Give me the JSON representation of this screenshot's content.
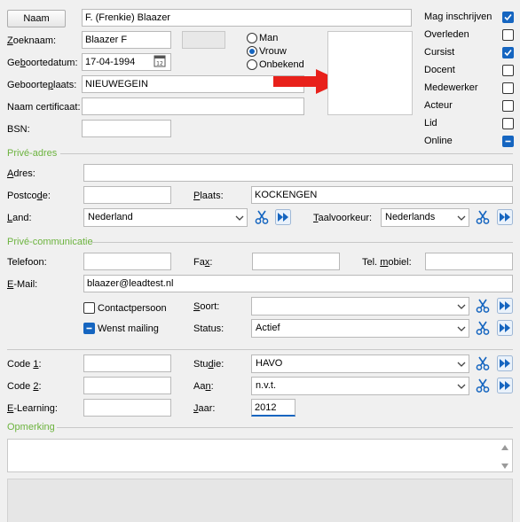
{
  "top": {
    "naam_button": "Naam",
    "naam_value": "F. (Frenkie) Blaazer",
    "zoeknaam_label": "Zoeknaam:",
    "zoeknaam_value": "Blaazer F",
    "geboortedatum_label": "Geboortedatum:",
    "geboortedatum_value": "17-04-1994",
    "geboorteplaats_label": "Geboorteplaats:",
    "geboorteplaats_value": "NIEUWEGEIN",
    "naam_certificaat_label": "Naam certificaat:",
    "naam_certificaat_value": "",
    "bsn_label": "BSN:",
    "bsn_value": "",
    "gender": [
      "Man",
      "Vrouw",
      "Onbekend"
    ],
    "gender_selected": "Vrouw"
  },
  "flags": [
    {
      "label": "Mag inschrijven",
      "state": "checked"
    },
    {
      "label": "Overleden",
      "state": "unchecked"
    },
    {
      "label": "Cursist",
      "state": "checked"
    },
    {
      "label": "Docent",
      "state": "unchecked"
    },
    {
      "label": "Medewerker",
      "state": "unchecked"
    },
    {
      "label": "Acteur",
      "state": "unchecked"
    },
    {
      "label": "Lid",
      "state": "unchecked"
    },
    {
      "label": "Online",
      "state": "indeterminate"
    }
  ],
  "prive_adres": {
    "section": "Privé-adres",
    "adres_label": "Adres:",
    "adres_value": "",
    "postcode_label": "Postcode:",
    "postcode_value": "",
    "plaats_label": "Plaats:",
    "plaats_value": "KOCKENGEN",
    "land_label": "Land:",
    "land_value": "Nederland",
    "taalvoorkeur_label": "Taalvoorkeur:",
    "taalvoorkeur_value": "Nederlands"
  },
  "prive_comm": {
    "section": "Privé-communicatie",
    "telefoon_label": "Telefoon:",
    "telefoon_value": "",
    "fax_label": "Fax:",
    "fax_value": "",
    "mobiel_label": "Tel. mobiel:",
    "mobiel_value": "",
    "email_label": "E-Mail:",
    "email_value": "blaazer@leadtest.nl",
    "contactpersoon_label": "Contactpersoon",
    "wenst_mailing_label": "Wenst mailing",
    "soort_label": "Soort:",
    "soort_value": "",
    "status_label": "Status:",
    "status_value": "Actief"
  },
  "extra": {
    "code1_label": "Code 1:",
    "code1_value": "",
    "code2_label": "Code 2:",
    "code2_value": "",
    "elearning_label": "E-Learning:",
    "elearning_value": "",
    "studie_label": "Studie:",
    "studie_value": "HAVO",
    "aan_label": "Aan:",
    "aan_value": "n.v.t.",
    "jaar_label": "Jaar:",
    "jaar_value": "2012"
  },
  "opmerking": {
    "section": "Opmerking",
    "value": ""
  },
  "colors": {
    "section_green": "#6cb33e",
    "checkbox_blue": "#1565c0",
    "arrow_red": "#e8211b"
  }
}
